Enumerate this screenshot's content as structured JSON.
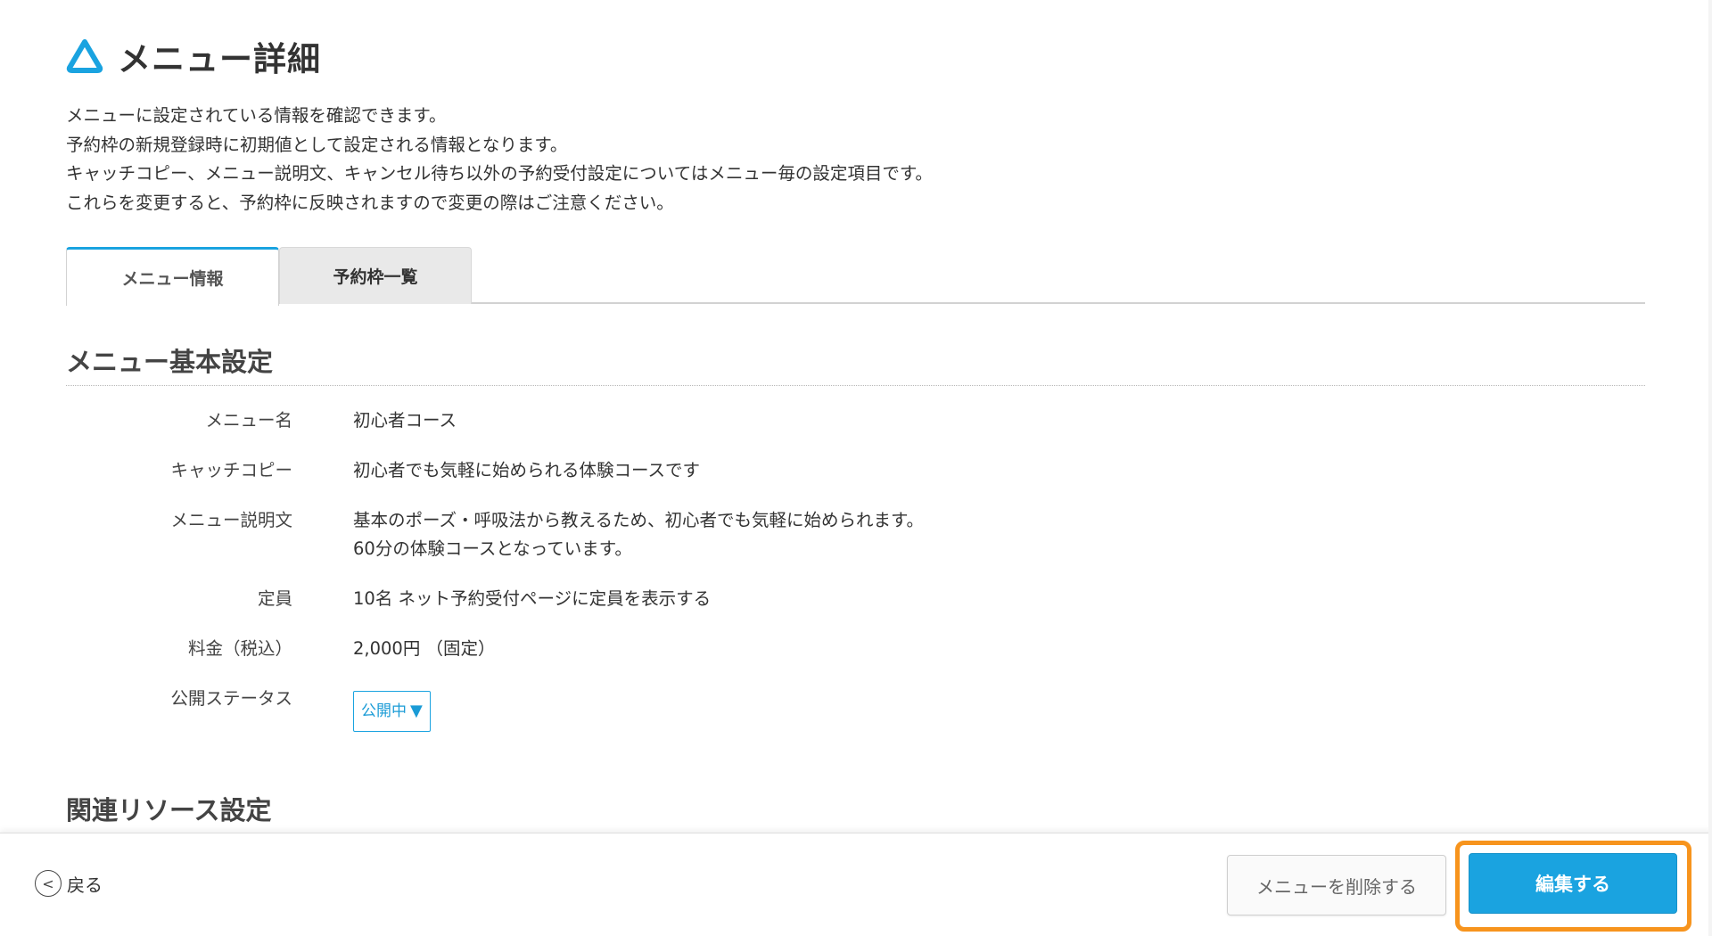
{
  "header": {
    "icon": "triangle-outline-icon",
    "title": "メニュー詳細"
  },
  "description": [
    "メニューに設定されている情報を確認できます。",
    "予約枠の新規登録時に初期値として設定される情報となります。",
    "キャッチコピー、メニュー説明文、キャンセル待ち以外の予約受付設定についてはメニュー毎の設定項目です。",
    "これらを変更すると、予約枠に反映されますので変更の際はご注意ください。"
  ],
  "tabs": [
    {
      "label": "メニュー情報",
      "active": true
    },
    {
      "label": "予約枠一覧",
      "active": false
    }
  ],
  "sections": {
    "basic": {
      "title": "メニュー基本設定",
      "rows": {
        "menu_name": {
          "label": "メニュー名",
          "value": "初心者コース"
        },
        "catchcopy": {
          "label": "キャッチコピー",
          "value": "初心者でも気軽に始められる体験コースです"
        },
        "description": {
          "label": "メニュー説明文",
          "value_line1": "基本のポーズ・呼吸法から教えるため、初心者でも気軽に始められます。",
          "value_line2": "60分の体験コースとなっています。"
        },
        "capacity": {
          "label": "定員",
          "value": "10名 ネット予約受付ページに定員を表示する"
        },
        "price": {
          "label": "料金（税込）",
          "value": "2,000円 （固定）"
        },
        "status": {
          "label": "公開ステータス",
          "value": "公開中",
          "arrow": "▼"
        }
      }
    },
    "resources": {
      "title": "関連リソース設定"
    }
  },
  "footer": {
    "back_label": "戻る",
    "back_icon": "chevron-left-circle-icon",
    "back_glyph": "<",
    "delete_label": "メニューを削除する",
    "edit_label": "編集する"
  },
  "colors": {
    "accent": "#1aa3e0",
    "highlight": "#f7941d"
  }
}
